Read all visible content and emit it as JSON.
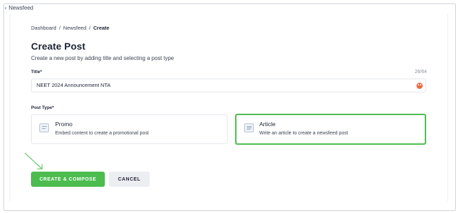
{
  "nav": {
    "back_label": "Newsfeed"
  },
  "breadcrumb": {
    "items": [
      "Dashboard",
      "Newsfeed"
    ],
    "separator": "/",
    "current": "Create"
  },
  "page": {
    "title": "Create Post",
    "subtitle": "Create a new post by adding title and selecting a post type"
  },
  "form": {
    "title_label": "Title*",
    "title_counter": "26/64",
    "title_value": "NEET 2024 Announcement NTA",
    "post_type_label": "Post Type*",
    "post_types": [
      {
        "title": "Promo",
        "description": "Embed content to create a promotional post",
        "icon": "image-icon",
        "selected": false
      },
      {
        "title": "Article",
        "description": "Write an article to create a newsfeed post",
        "icon": "document-icon",
        "selected": true
      }
    ]
  },
  "actions": {
    "create_label": "CREATE & COMPOSE",
    "cancel_label": "CANCEL"
  },
  "colors": {
    "accent": "#4cbc4f",
    "selected_border": "#4cbc4f",
    "emoji": "#f0683f"
  }
}
